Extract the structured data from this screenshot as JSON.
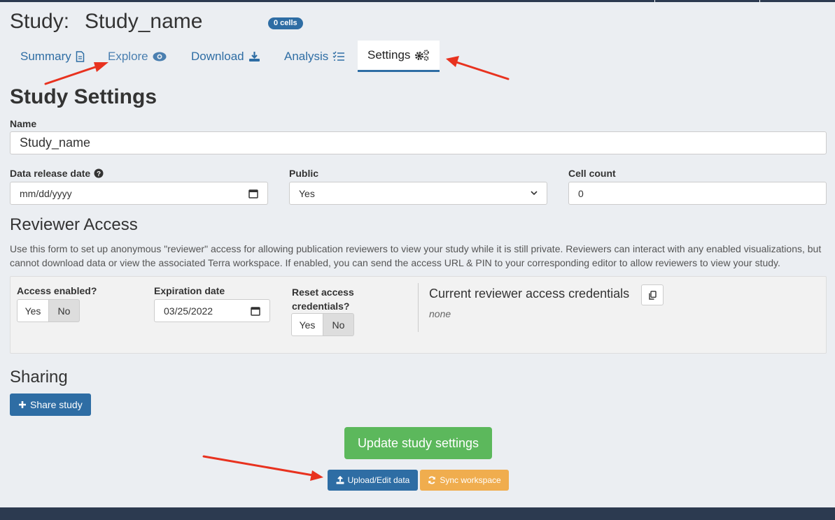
{
  "header": {
    "study_label": "Study:",
    "study_name": "Study_name",
    "cells_badge": "0 cells"
  },
  "tabs": [
    {
      "label": "Summary",
      "icon": "document-icon"
    },
    {
      "label": "Explore",
      "icon": "eye-icon"
    },
    {
      "label": "Download",
      "icon": "download-icon"
    },
    {
      "label": "Analysis",
      "icon": "list-check-icon"
    },
    {
      "label": "Settings",
      "icon": "gears-icon",
      "active": true
    }
  ],
  "settings": {
    "title": "Study Settings",
    "name_label": "Name",
    "name_value": "Study_name",
    "release_label": "Data release date",
    "release_placeholder": "mm/dd/yyyy",
    "public_label": "Public",
    "public_value": "Yes",
    "cell_count_label": "Cell count",
    "cell_count_value": "0"
  },
  "reviewer": {
    "title": "Reviewer Access",
    "description": "Use this form to set up anonymous \"reviewer\" access for allowing publication reviewers to view your study while it is still private. Reviewers can interact with any enabled visualizations, but cannot download data or view the associated Terra workspace. If enabled, you can send the access URL & PIN to your corresponding editor to allow reviewers to view your study.",
    "access_label": "Access enabled?",
    "yes": "Yes",
    "no": "No",
    "expiration_label": "Expiration date",
    "expiration_value": "03/25/2022",
    "reset_label_1": "Reset access",
    "reset_label_2": "credentials?",
    "credentials_title": "Current reviewer access credentials",
    "credentials_value": "none"
  },
  "sharing": {
    "title": "Sharing",
    "share_button": "Share study"
  },
  "actions": {
    "update": "Update study settings",
    "upload": "Upload/Edit data",
    "sync": "Sync workspace"
  },
  "colors": {
    "primary": "#2e6da4",
    "success": "#5cb85c",
    "warning": "#f0ad4e",
    "annotation_arrow": "#e8321f"
  }
}
